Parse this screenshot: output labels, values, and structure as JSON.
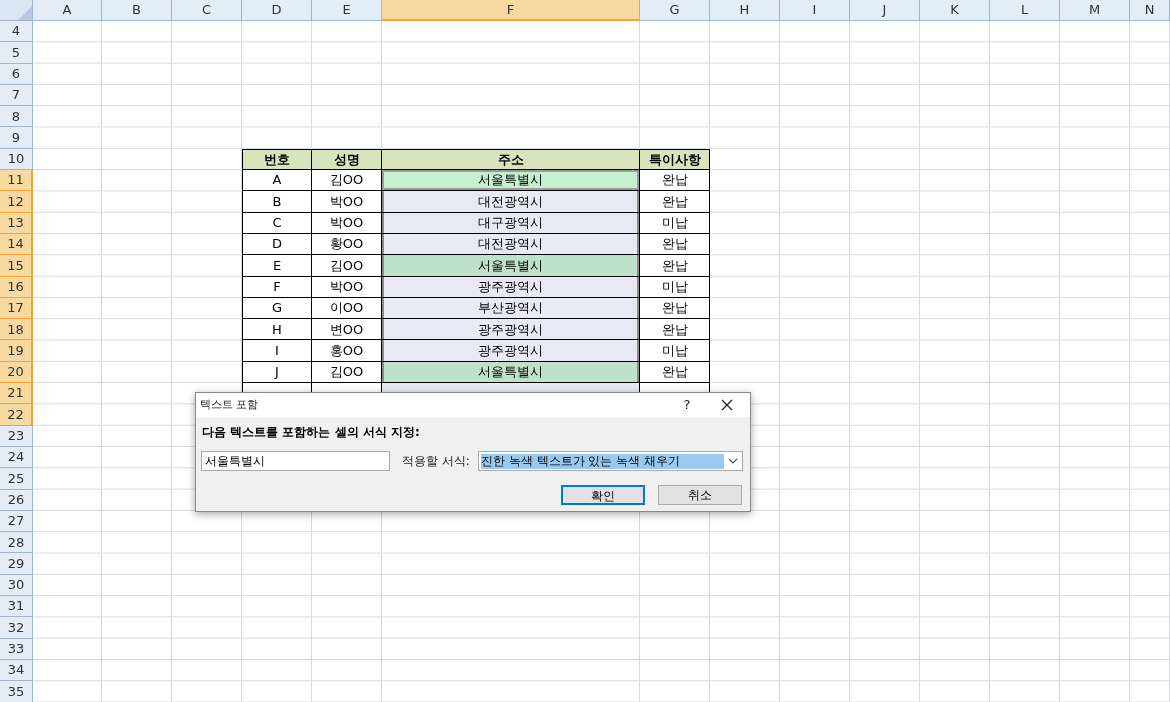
{
  "columns": [
    {
      "label": "A",
      "selected": false
    },
    {
      "label": "B",
      "selected": false
    },
    {
      "label": "C",
      "selected": false
    },
    {
      "label": "D",
      "selected": false
    },
    {
      "label": "E",
      "selected": false
    },
    {
      "label": "F",
      "selected": true
    },
    {
      "label": "G",
      "selected": false
    },
    {
      "label": "H",
      "selected": false
    },
    {
      "label": "I",
      "selected": false
    },
    {
      "label": "J",
      "selected": false
    },
    {
      "label": "K",
      "selected": false
    },
    {
      "label": "L",
      "selected": false
    },
    {
      "label": "M",
      "selected": false
    },
    {
      "label": "N",
      "selected": false
    }
  ],
  "rows": [
    {
      "label": "4",
      "selected": false
    },
    {
      "label": "5",
      "selected": false
    },
    {
      "label": "6",
      "selected": false
    },
    {
      "label": "7",
      "selected": false
    },
    {
      "label": "8",
      "selected": false
    },
    {
      "label": "9",
      "selected": false
    },
    {
      "label": "10",
      "selected": false
    },
    {
      "label": "11",
      "selected": true
    },
    {
      "label": "12",
      "selected": true
    },
    {
      "label": "13",
      "selected": true
    },
    {
      "label": "14",
      "selected": true
    },
    {
      "label": "15",
      "selected": true
    },
    {
      "label": "16",
      "selected": true
    },
    {
      "label": "17",
      "selected": true
    },
    {
      "label": "18",
      "selected": true
    },
    {
      "label": "19",
      "selected": true
    },
    {
      "label": "20",
      "selected": true
    },
    {
      "label": "21",
      "selected": true
    },
    {
      "label": "22",
      "selected": true
    },
    {
      "label": "23",
      "selected": false
    },
    {
      "label": "24",
      "selected": false
    },
    {
      "label": "25",
      "selected": false
    },
    {
      "label": "26",
      "selected": false
    },
    {
      "label": "27",
      "selected": false
    },
    {
      "label": "28",
      "selected": false
    },
    {
      "label": "29",
      "selected": false
    },
    {
      "label": "30",
      "selected": false
    },
    {
      "label": "31",
      "selected": false
    },
    {
      "label": "32",
      "selected": false
    },
    {
      "label": "33",
      "selected": false
    },
    {
      "label": "34",
      "selected": false
    },
    {
      "label": "35",
      "selected": false
    }
  ],
  "table": {
    "header": [
      "번호",
      "성명",
      "주소",
      "특이사항"
    ],
    "rows": [
      {
        "no": "A",
        "name": "김OO",
        "address": "서울특별시",
        "note": "완납",
        "highlight": true,
        "active": true
      },
      {
        "no": "B",
        "name": "박OO",
        "address": "대전광역시",
        "note": "완납",
        "highlight": false,
        "active": false
      },
      {
        "no": "C",
        "name": "박OO",
        "address": "대구광역시",
        "note": "미납",
        "highlight": false,
        "active": false
      },
      {
        "no": "D",
        "name": "황OO",
        "address": "대전광역시",
        "note": "완납",
        "highlight": false,
        "active": false
      },
      {
        "no": "E",
        "name": "김OO",
        "address": "서울특별시",
        "note": "완납",
        "highlight": true,
        "active": false
      },
      {
        "no": "F",
        "name": "박OO",
        "address": "광주광역시",
        "note": "미납",
        "highlight": false,
        "active": false
      },
      {
        "no": "G",
        "name": "이OO",
        "address": "부산광역시",
        "note": "완납",
        "highlight": false,
        "active": false
      },
      {
        "no": "H",
        "name": "변OO",
        "address": "광주광역시",
        "note": "완납",
        "highlight": false,
        "active": false
      },
      {
        "no": "I",
        "name": "홍OO",
        "address": "광주광역시",
        "note": "미납",
        "highlight": false,
        "active": false
      },
      {
        "no": "J",
        "name": "김OO",
        "address": "서울특별시",
        "note": "완납",
        "highlight": true,
        "active": false
      }
    ]
  },
  "dialog": {
    "title": "텍스트 포함",
    "help": "?",
    "prompt": "다음 텍스트를 포함하는 셀의 서식 지정:",
    "value": "서울특별시",
    "format_label": "적용할 서식:",
    "format_value": "진한 녹색 텍스트가 있는 녹색 채우기",
    "ok": "확인",
    "cancel": "취소"
  }
}
